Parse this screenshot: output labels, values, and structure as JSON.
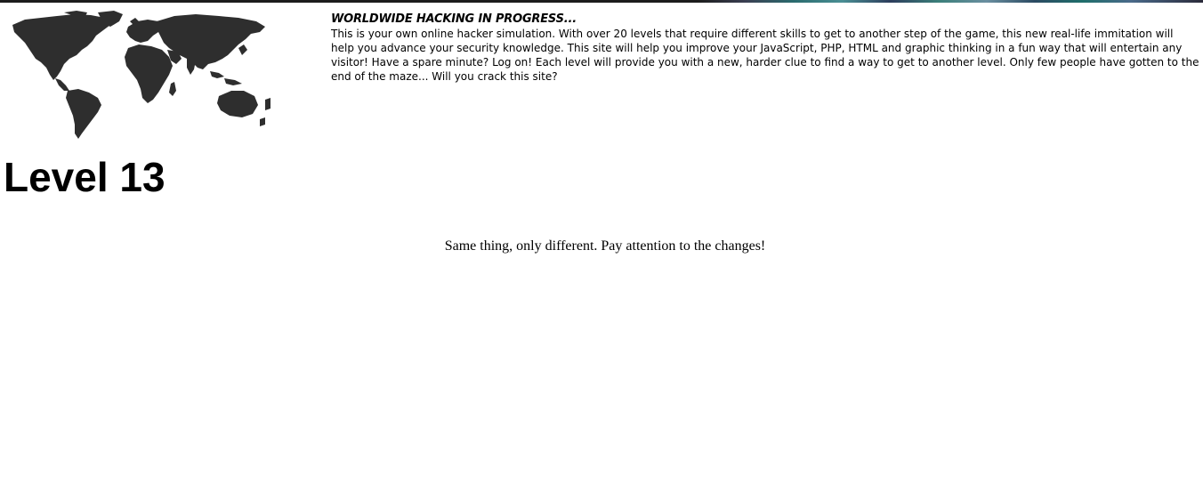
{
  "header": {
    "map_icon": "world-map-icon"
  },
  "intro": {
    "heading": "WORLDWIDE HACKING IN PROGRESS...",
    "text": "This is your own online hacker simulation. With over 20 levels that require different skills to get to another step of the game, this new real-life immitation will help you advance your security knowledge. This site will help you improve your JavaScript, PHP, HTML and graphic thinking in a fun way that will entertain any visitor! Have a spare minute? Log on! Each level will provide you with a new, harder clue to find a way to get to another level. Only few people have gotten to the end of the maze... Will you crack this site?"
  },
  "level": {
    "title": "Level 13",
    "hint": "Same thing, only different. Pay attention to the changes!"
  }
}
